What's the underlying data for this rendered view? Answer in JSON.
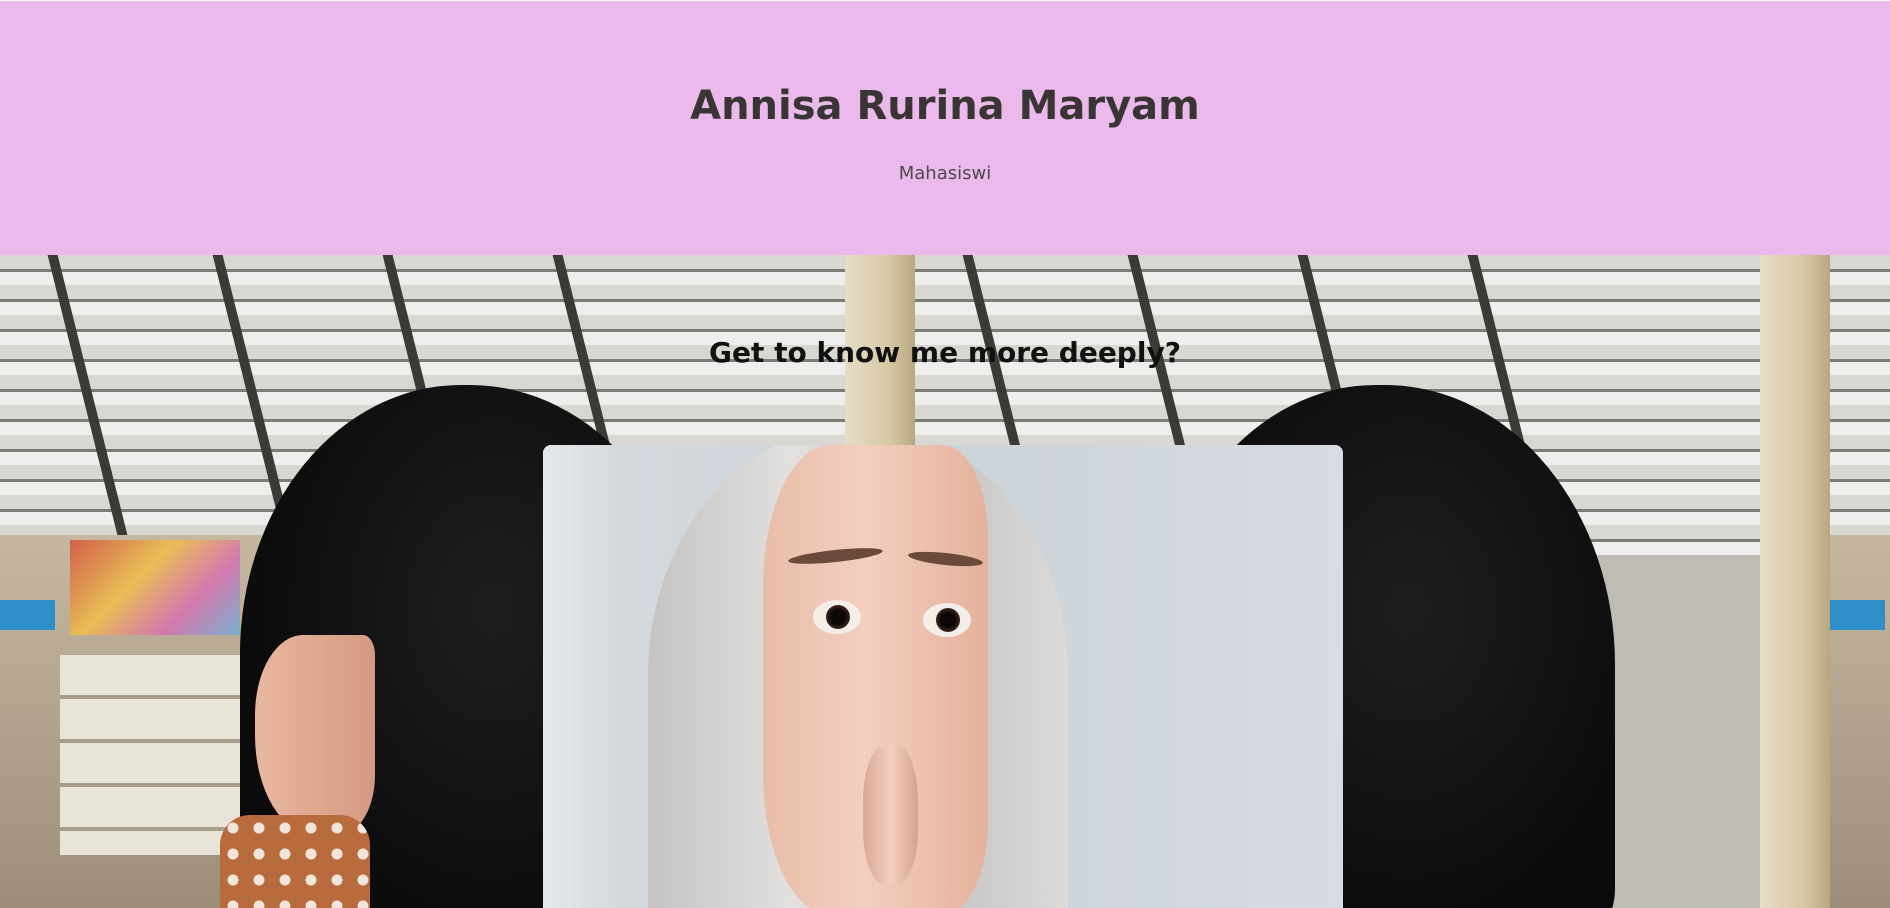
{
  "header": {
    "name": "Annisa Rurina Maryam",
    "role": "Mahasiswi"
  },
  "about": {
    "title": "Get to know me more deeply?"
  },
  "colors": {
    "header_background": "#ebb9eb",
    "title_text": "#3a3535"
  }
}
